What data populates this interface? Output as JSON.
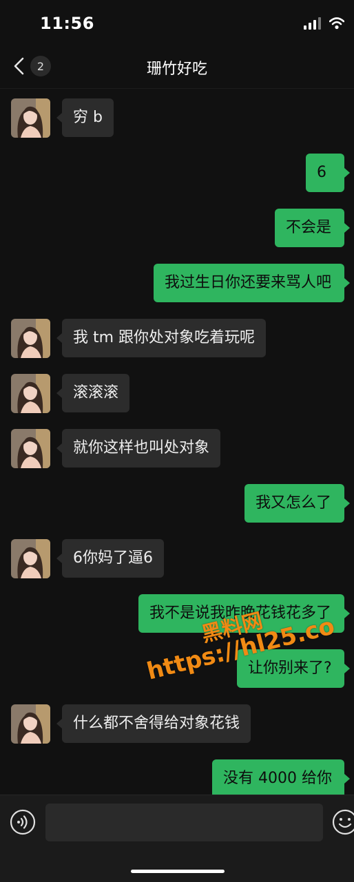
{
  "status_bar": {
    "time": "11:56"
  },
  "nav": {
    "unread_count": "2",
    "title": "珊竹好吃"
  },
  "messages": [
    {
      "side": "in",
      "text": "穷 b"
    },
    {
      "side": "out",
      "text": "6"
    },
    {
      "side": "out",
      "text": "不会是"
    },
    {
      "side": "out",
      "text": "我过生日你还要来骂人吧"
    },
    {
      "side": "in",
      "text": "我 tm 跟你处对象吃着玩呢"
    },
    {
      "side": "in",
      "text": "滚滚滚"
    },
    {
      "side": "in",
      "text": "就你这样也叫处对象"
    },
    {
      "side": "out",
      "text": "我又怎么了"
    },
    {
      "side": "in",
      "text": "6你妈了逼6"
    },
    {
      "side": "out",
      "text": "我不是说我昨晚花钱花多了"
    },
    {
      "side": "out",
      "text": "让你别来了?"
    },
    {
      "side": "in",
      "text": "什么都不舍得给对象花钱"
    },
    {
      "side": "out",
      "text": "没有 4000 给你"
    }
  ],
  "watermark": {
    "line1": "黑料网",
    "line2": "https://hl25.co"
  },
  "input": {
    "placeholder": ""
  },
  "colors": {
    "background": "#111111",
    "incoming_bubble": "#2c2c2c",
    "outgoing_bubble": "#2fb55f",
    "watermark": "#f08a14"
  },
  "icons": {
    "back": "chevron-left-icon",
    "voice": "voice-icon",
    "emoji": "emoji-icon",
    "signal": "signal-icon",
    "wifi": "wifi-icon"
  }
}
